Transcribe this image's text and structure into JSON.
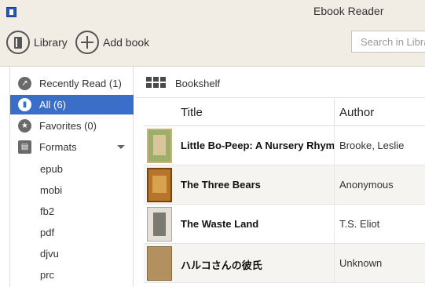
{
  "window": {
    "title": "Ebook Reader"
  },
  "toolbar": {
    "library_label": "Library",
    "add_book_label": "Add book",
    "search_placeholder": "Search in Library"
  },
  "sidebar": {
    "items": [
      {
        "label": "Recently Read (1)",
        "icon": "clock-icon"
      },
      {
        "label": "All (6)",
        "icon": "book-icon",
        "active": true
      },
      {
        "label": "Favorites (0)",
        "icon": "star-icon"
      },
      {
        "label": "Formats",
        "icon": "formats-icon"
      }
    ],
    "formats": [
      "epub",
      "mobi",
      "fb2",
      "pdf",
      "djvu",
      "prc"
    ]
  },
  "view": {
    "label": "Bookshelf",
    "icon": "grid-icon"
  },
  "table": {
    "columns": {
      "title": "Title",
      "author": "Author"
    },
    "rows": [
      {
        "title": "Little Bo-Peep: A Nursery Rhyme Picture Book",
        "author": "Brooke, Leslie",
        "cover_color": "#9cae6a"
      },
      {
        "title": "The Three Bears",
        "author": "Anonymous",
        "cover_color": "#b8742a"
      },
      {
        "title": "The Waste Land",
        "author": "T.S. Eliot",
        "cover_color": "#7a7a70"
      },
      {
        "title": "ハルコさんの彼氏",
        "author": "Unknown",
        "cover_color": "#b39060"
      }
    ]
  },
  "colors": {
    "accent": "#3b6ec8",
    "background": "#f2ede4"
  }
}
